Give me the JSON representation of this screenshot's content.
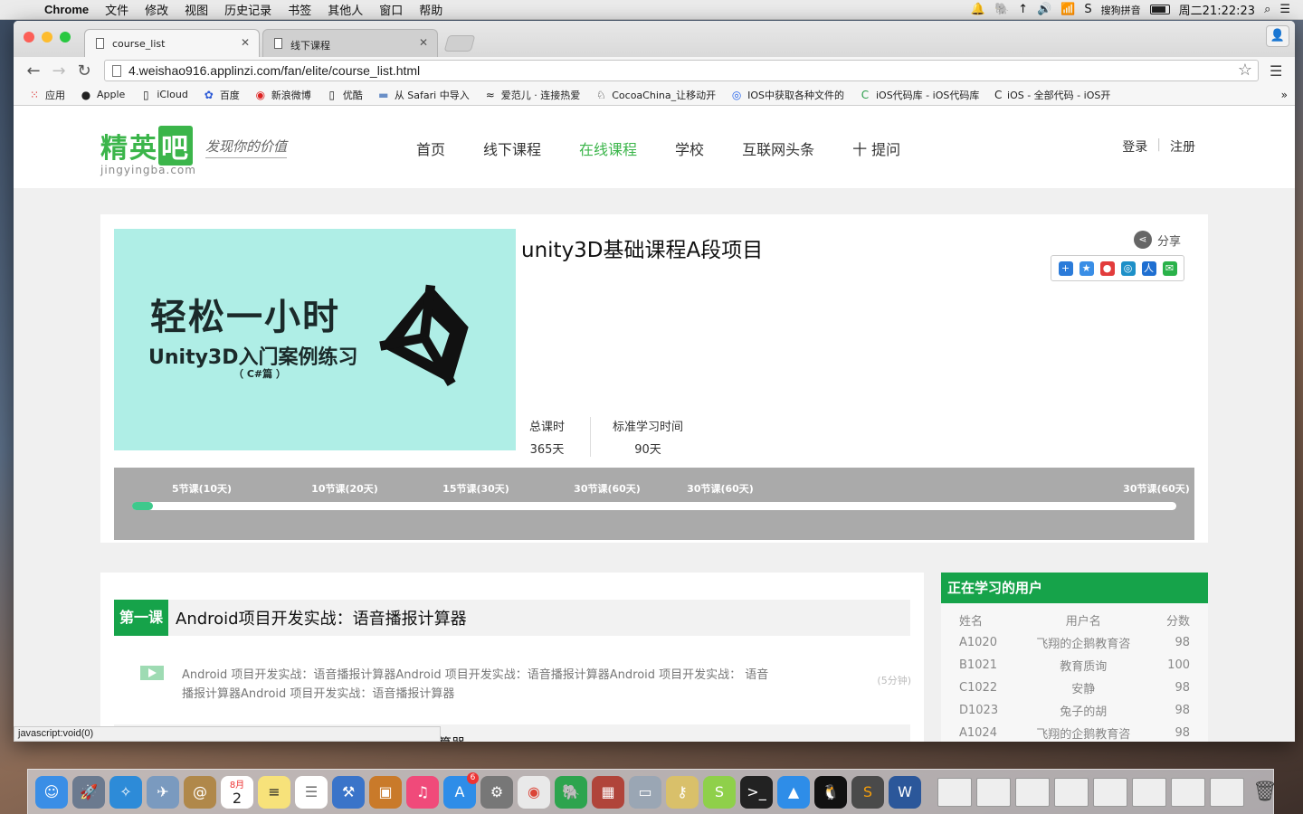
{
  "menubar": {
    "app": "Chrome",
    "items": [
      "文件",
      "修改",
      "视图",
      "历史记录",
      "书签",
      "其他人",
      "窗口",
      "帮助"
    ],
    "ime": "搜狗拼音",
    "clock": "周二21:22:23"
  },
  "browser": {
    "tabs": [
      {
        "label": "course_list"
      },
      {
        "label": "线下课程"
      }
    ],
    "url": "4.weishao916.applinzi.com/fan/elite/course_list.html",
    "bookmarks": [
      {
        "label": "应用",
        "icon": "apps-grid-icon"
      },
      {
        "label": "Apple",
        "icon": "apple-icon"
      },
      {
        "label": "iCloud",
        "icon": "page-icon"
      },
      {
        "label": "百度",
        "icon": "baidu-paw-icon"
      },
      {
        "label": "新浪微博",
        "icon": "weibo-icon"
      },
      {
        "label": "优酷",
        "icon": "page-icon"
      },
      {
        "label": "从 Safari 中导入",
        "icon": "folder-icon"
      },
      {
        "label": "爱范儿 · 连接热爱",
        "icon": "ifanr-icon"
      },
      {
        "label": "CocoaChina_让移动开",
        "icon": "cocoachina-icon"
      },
      {
        "label": "IOS中获取各种文件的",
        "icon": "blue-globe-icon"
      },
      {
        "label": "iOS代码库 - iOS代码库",
        "icon": "code4app-icon"
      },
      {
        "label": "iOS - 全部代码 - iOS开",
        "icon": "c-icon"
      }
    ],
    "more": "»",
    "status": "javascript:void(0)"
  },
  "site": {
    "logo_main": "精英",
    "logo_box": "吧",
    "logo_sub": "jingyingba.com",
    "slogan": "发现你的价值",
    "nav": [
      "首页",
      "线下课程",
      "在线课程",
      "学校",
      "互联网头条",
      "十 提问"
    ],
    "login": "登录",
    "register": "注册"
  },
  "course": {
    "cover_line1": "轻松一小时",
    "cover_line2": "Unity3D入门案例练习",
    "cover_line3": "（ C#篇 ）",
    "title": "unity3D基础课程A段项目",
    "share": "分享",
    "stat1_label": "总课时",
    "stat1_value": "365天",
    "stat2_label": "标准学习时间",
    "stat2_value": "90天",
    "progress": 0.02,
    "milestones": [
      "5节课(10天)",
      "10节课(20天)",
      "15节课(30天)",
      "30节课(60天)",
      "30节课(60天)",
      "30节课(60天)"
    ]
  },
  "lessons": {
    "badge": "第一课",
    "title": "Android项目开发实战：语音播报计算器",
    "item_text": "Android 项目开发实战：语音播报计算器Android 项目开发实战：语音播报计算器Android 项目开发实战： 语音播报计算器Android 项目开发实战：语音播报计算器",
    "item_duration": "(5分钟)",
    "next_title_fragment": "算器"
  },
  "learners": {
    "title": "正在学习的用户",
    "headers": [
      "姓名",
      "用户名",
      "分数"
    ],
    "rows": [
      [
        "A1020",
        "飞翔的企鹅教育咨",
        "98"
      ],
      [
        "B1021",
        "教育质询",
        "100"
      ],
      [
        "C1022",
        "安静",
        "98"
      ],
      [
        "D1023",
        "兔子的胡",
        "98"
      ],
      [
        "A1024",
        "飞翔的企鹅教育咨",
        "98"
      ]
    ]
  },
  "dock": {
    "calendar_month": "8月",
    "calendar_day": "2",
    "appstore_badge": "6"
  }
}
